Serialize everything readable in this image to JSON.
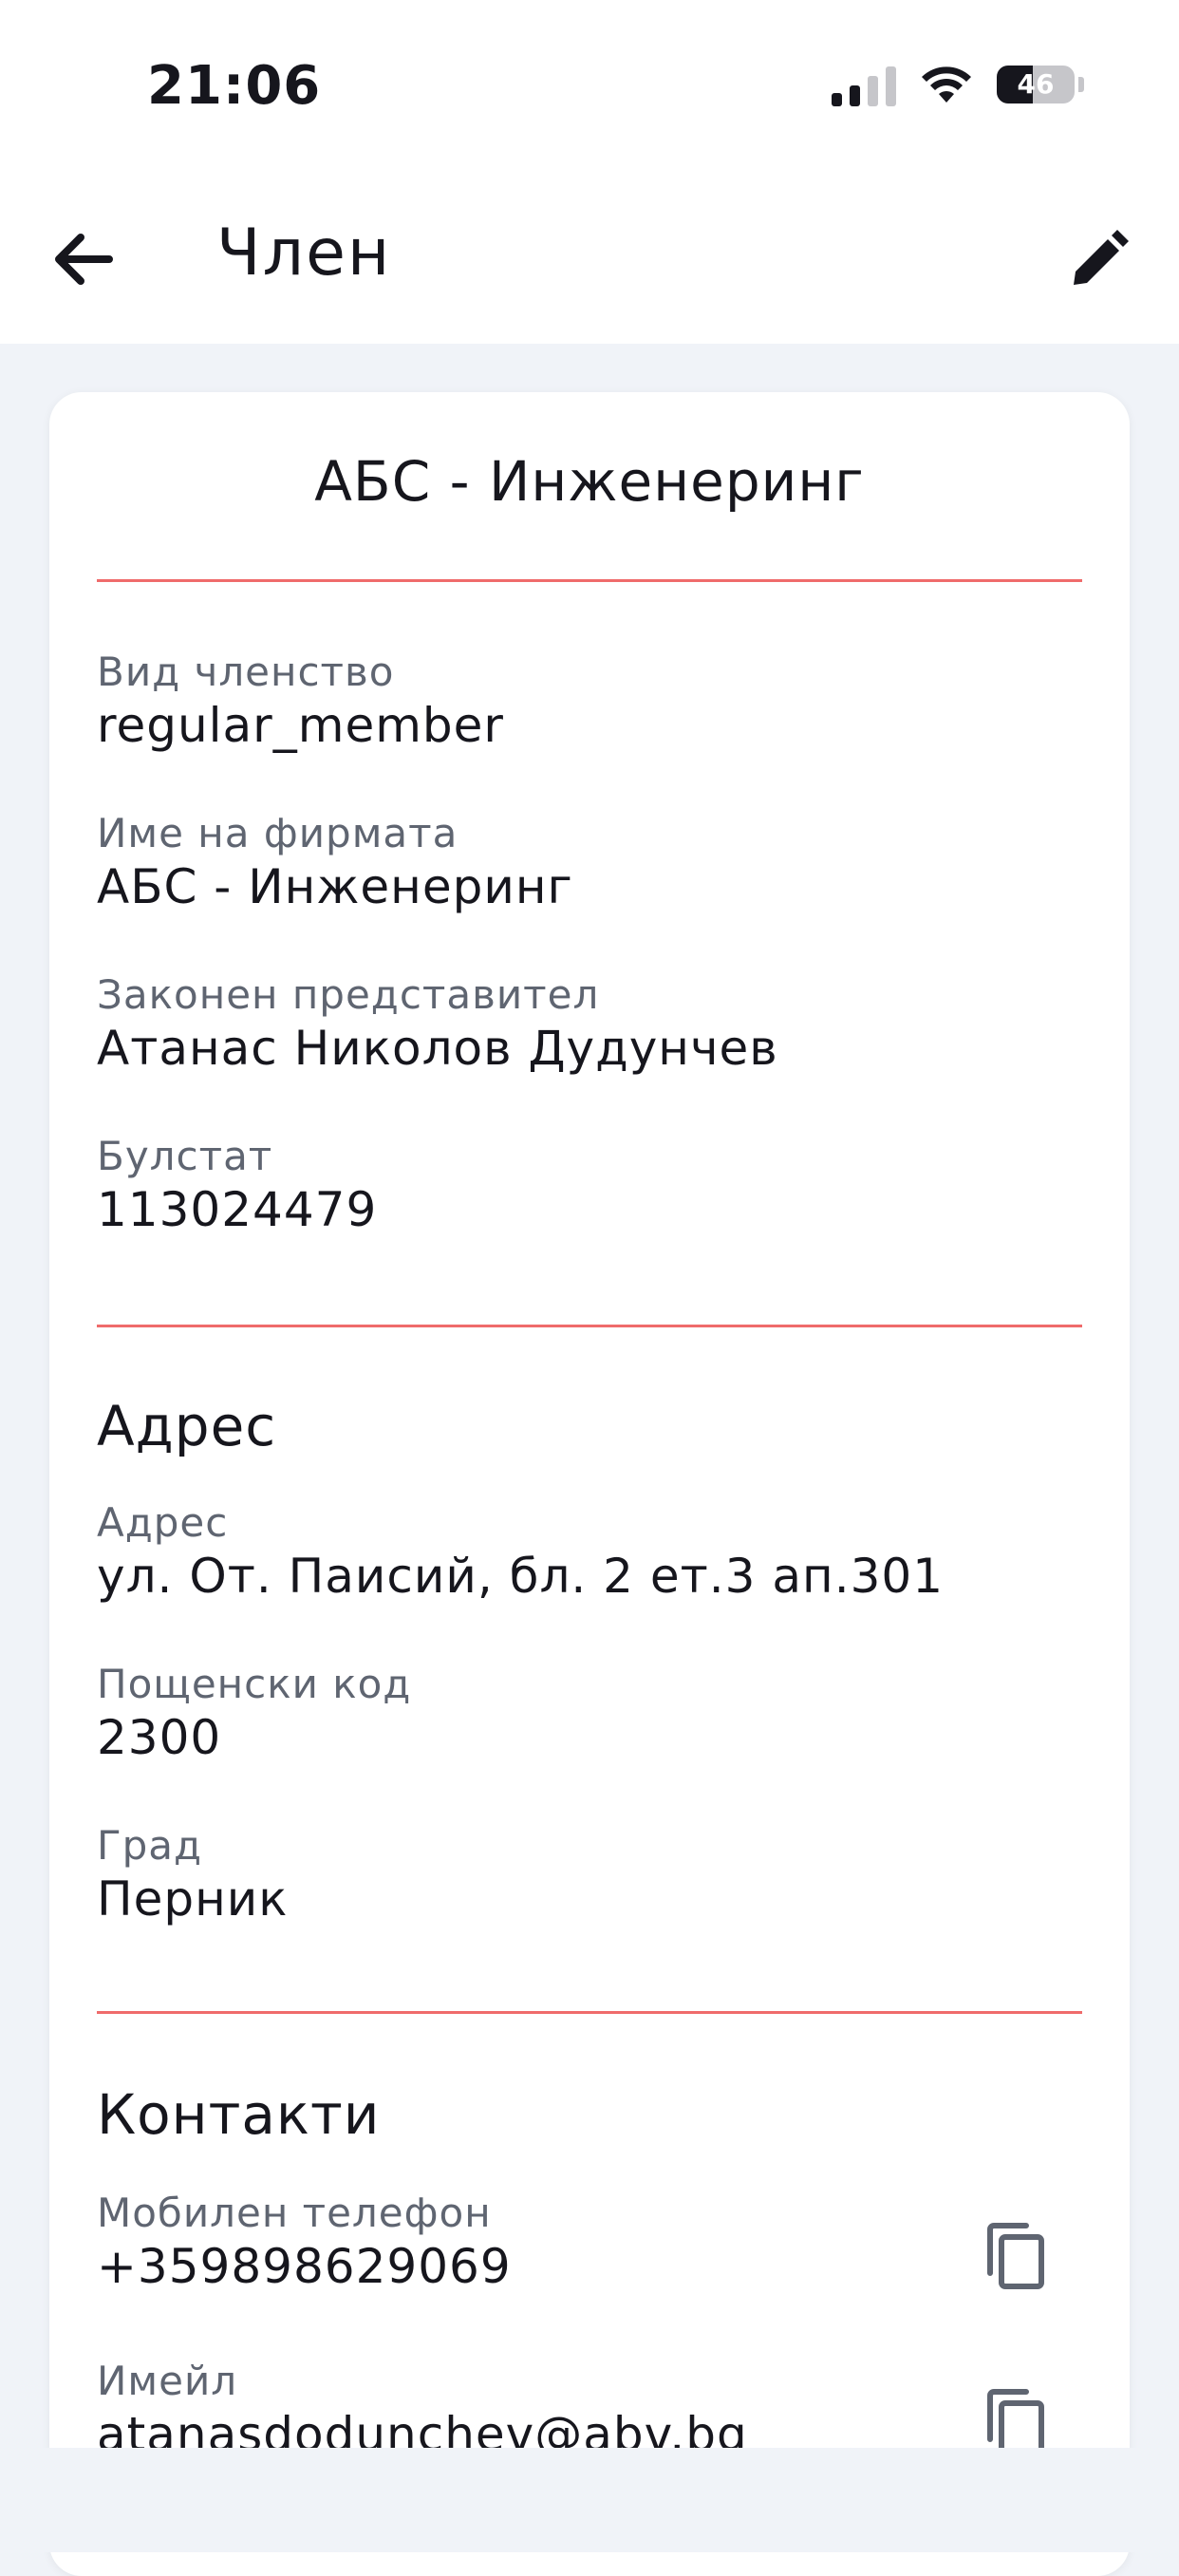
{
  "status_bar": {
    "time": "21:06",
    "battery_level": "46",
    "icons": [
      "cellular-signal-icon",
      "wifi-icon",
      "battery-icon"
    ]
  },
  "app_bar": {
    "title": "Член",
    "back_icon": "arrow-left-icon",
    "edit_icon": "pencil-icon"
  },
  "card": {
    "title": "АБС - Инженеринг",
    "general": {
      "membership_label": "Вид членство",
      "membership_value": "regular_member",
      "company_label": "Име на фирмата",
      "company_value": "АБС - Инженеринг",
      "representative_label": "Законен представител",
      "representative_value": "Атанас Николов Дудунчев",
      "bulstat_label": "Булстат",
      "bulstat_value": "113024479"
    },
    "address": {
      "title": "Адрес",
      "address_label": "Адрес",
      "address_value": "ул. От. Паисий, бл. 2 ет.3 ап.301",
      "postal_label": "Пощенски код",
      "postal_value": "2300",
      "city_label": "Град",
      "city_value": "Перник"
    },
    "contacts": {
      "title": "Контакти",
      "phone_label": "Мобилен телефон",
      "phone_value": "+359898629069",
      "email_label": "Имейл",
      "email_value": "atanasdodunchev@abv.bg",
      "copy_icon": "copy-icon"
    }
  },
  "colors": {
    "divider": "#ef6b6b",
    "background": "#f0f3f8",
    "card": "#ffffff",
    "label": "#5f6571",
    "text": "#16161d"
  }
}
